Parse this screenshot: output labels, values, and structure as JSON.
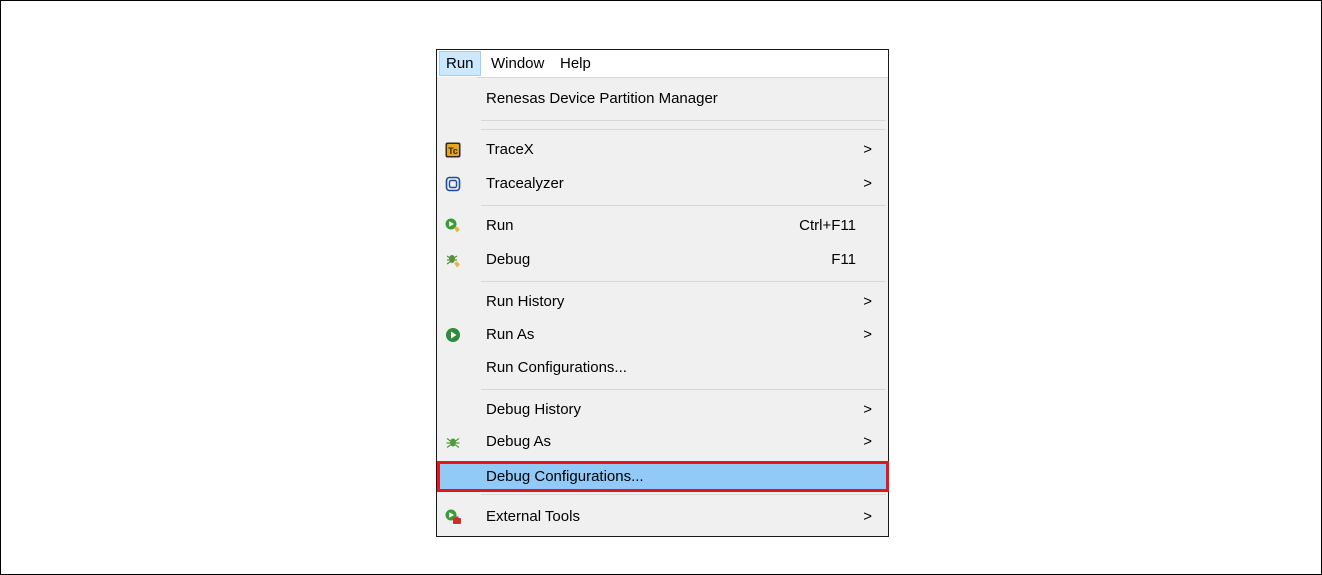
{
  "menubar": {
    "items": [
      {
        "label": "Run"
      },
      {
        "label": "Window"
      },
      {
        "label": "Help"
      }
    ]
  },
  "menu": {
    "items": [
      {
        "label": "Renesas Device Partition Manager",
        "shortcut": "",
        "submenu": false,
        "icon": ""
      },
      {
        "label": "TraceX",
        "shortcut": "",
        "submenu": true,
        "icon": "tracex-icon"
      },
      {
        "label": "Tracealyzer",
        "shortcut": "",
        "submenu": true,
        "icon": "tracealyzer-icon"
      },
      {
        "label": "Run",
        "shortcut": "Ctrl+F11",
        "submenu": false,
        "icon": "run-icon"
      },
      {
        "label": "Debug",
        "shortcut": "F11",
        "submenu": false,
        "icon": "debug-icon"
      },
      {
        "label": "Run History",
        "shortcut": "",
        "submenu": true,
        "icon": ""
      },
      {
        "label": "Run As",
        "shortcut": "",
        "submenu": true,
        "icon": "run-as-icon"
      },
      {
        "label": "Run Configurations...",
        "shortcut": "",
        "submenu": false,
        "icon": ""
      },
      {
        "label": "Debug History",
        "shortcut": "",
        "submenu": true,
        "icon": ""
      },
      {
        "label": "Debug As",
        "shortcut": "",
        "submenu": true,
        "icon": "debug-as-icon"
      },
      {
        "label": "Debug Configurations...",
        "shortcut": "",
        "submenu": false,
        "icon": "",
        "selected": true
      },
      {
        "label": "External Tools",
        "shortcut": "",
        "submenu": true,
        "icon": "external-tools-icon"
      }
    ],
    "submenu_arrow": ">"
  },
  "colors": {
    "selected_row": "#91c9f7",
    "highlight_border": "#e8141b"
  }
}
